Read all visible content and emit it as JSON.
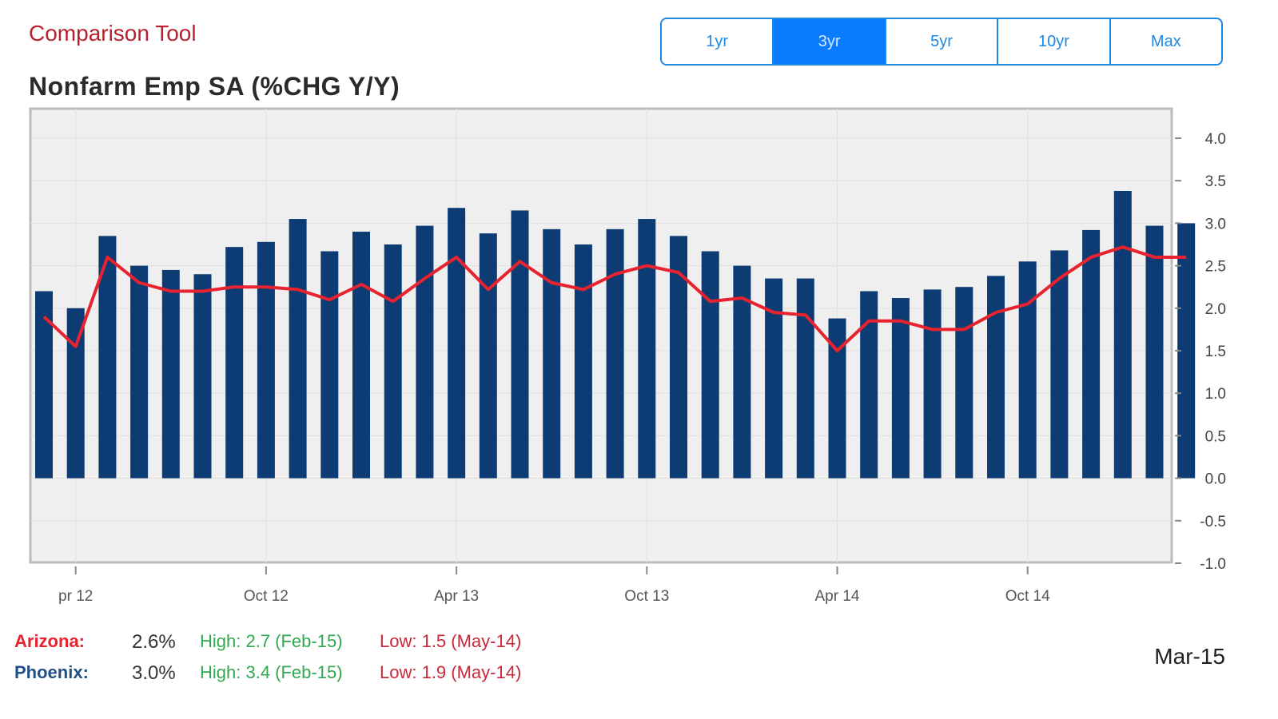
{
  "app": {
    "title": "Comparison Tool"
  },
  "range_buttons": [
    {
      "label": "1yr",
      "active": false
    },
    {
      "label": "3yr",
      "active": true
    },
    {
      "label": "5yr",
      "active": false
    },
    {
      "label": "10yr",
      "active": false
    },
    {
      "label": "Max",
      "active": false
    }
  ],
  "chart_title": "Nonfarm Emp SA (%CHG Y/Y)",
  "colors": {
    "bar": "#0d3b73",
    "line": "#e8232f",
    "plot_bg": "#efefef",
    "brand_red": "#b8202e",
    "accent_blue": "#1e88e5"
  },
  "chart_data": {
    "type": "bar",
    "title": "Nonfarm Emp SA (%CHG Y/Y)",
    "x": [
      "Mar-12",
      "Apr-12",
      "May-12",
      "Jun-12",
      "Jul-12",
      "Aug-12",
      "Sep-12",
      "Oct-12",
      "Nov-12",
      "Dec-12",
      "Jan-13",
      "Feb-13",
      "Mar-13",
      "Apr-13",
      "May-13",
      "Jun-13",
      "Jul-13",
      "Aug-13",
      "Sep-13",
      "Oct-13",
      "Nov-13",
      "Dec-13",
      "Jan-14",
      "Feb-14",
      "Mar-14",
      "Apr-14",
      "May-14",
      "Jun-14",
      "Jul-14",
      "Aug-14",
      "Sep-14",
      "Oct-14",
      "Nov-14",
      "Dec-14",
      "Jan-15",
      "Feb-15",
      "Mar-15"
    ],
    "x_tick_labels": [
      {
        "index": 1,
        "label": "pr 12"
      },
      {
        "index": 7,
        "label": "Oct 12"
      },
      {
        "index": 13,
        "label": "Apr 13"
      },
      {
        "index": 19,
        "label": "Oct 13"
      },
      {
        "index": 25,
        "label": "Apr 14"
      },
      {
        "index": 31,
        "label": "Oct 14"
      }
    ],
    "series": [
      {
        "name": "Phoenix",
        "type": "bar",
        "values": [
          2.2,
          2.0,
          2.85,
          2.5,
          2.45,
          2.4,
          2.72,
          2.78,
          3.05,
          2.67,
          2.9,
          2.75,
          2.97,
          3.18,
          2.88,
          3.15,
          2.93,
          2.75,
          2.93,
          3.05,
          2.85,
          2.67,
          2.5,
          2.35,
          2.35,
          1.88,
          2.2,
          2.12,
          2.22,
          2.25,
          2.38,
          2.55,
          2.68,
          2.92,
          3.38,
          2.97,
          3.0
        ]
      },
      {
        "name": "Arizona",
        "type": "line",
        "values": [
          1.9,
          1.55,
          2.6,
          2.3,
          2.2,
          2.2,
          2.25,
          2.25,
          2.22,
          2.1,
          2.28,
          2.08,
          2.35,
          2.6,
          2.22,
          2.55,
          2.3,
          2.22,
          2.4,
          2.5,
          2.42,
          2.08,
          2.12,
          1.95,
          1.92,
          1.5,
          1.85,
          1.85,
          1.75,
          1.75,
          1.95,
          2.05,
          2.35,
          2.6,
          2.72,
          2.6,
          2.6
        ]
      }
    ],
    "yticks": [
      "4.0",
      "3.5",
      "3.0",
      "2.5",
      "2.0",
      "1.5",
      "1.0",
      "0.5",
      "0.0",
      "-0.5",
      "-1.0"
    ],
    "ylim": [
      -1.0,
      4.2
    ],
    "grid": true
  },
  "legend": [
    {
      "name": "Arizona:",
      "value": "2.6%",
      "high": "High: 2.7 (Feb-15)",
      "low": "Low: 1.5 (May-14)",
      "color": "#e8232f"
    },
    {
      "name": "Phoenix:",
      "value": "3.0%",
      "high": "High: 3.4 (Feb-15)",
      "low": "Low: 1.9 (May-14)",
      "color": "#1f4f86"
    }
  ],
  "current_date": "Mar-15"
}
